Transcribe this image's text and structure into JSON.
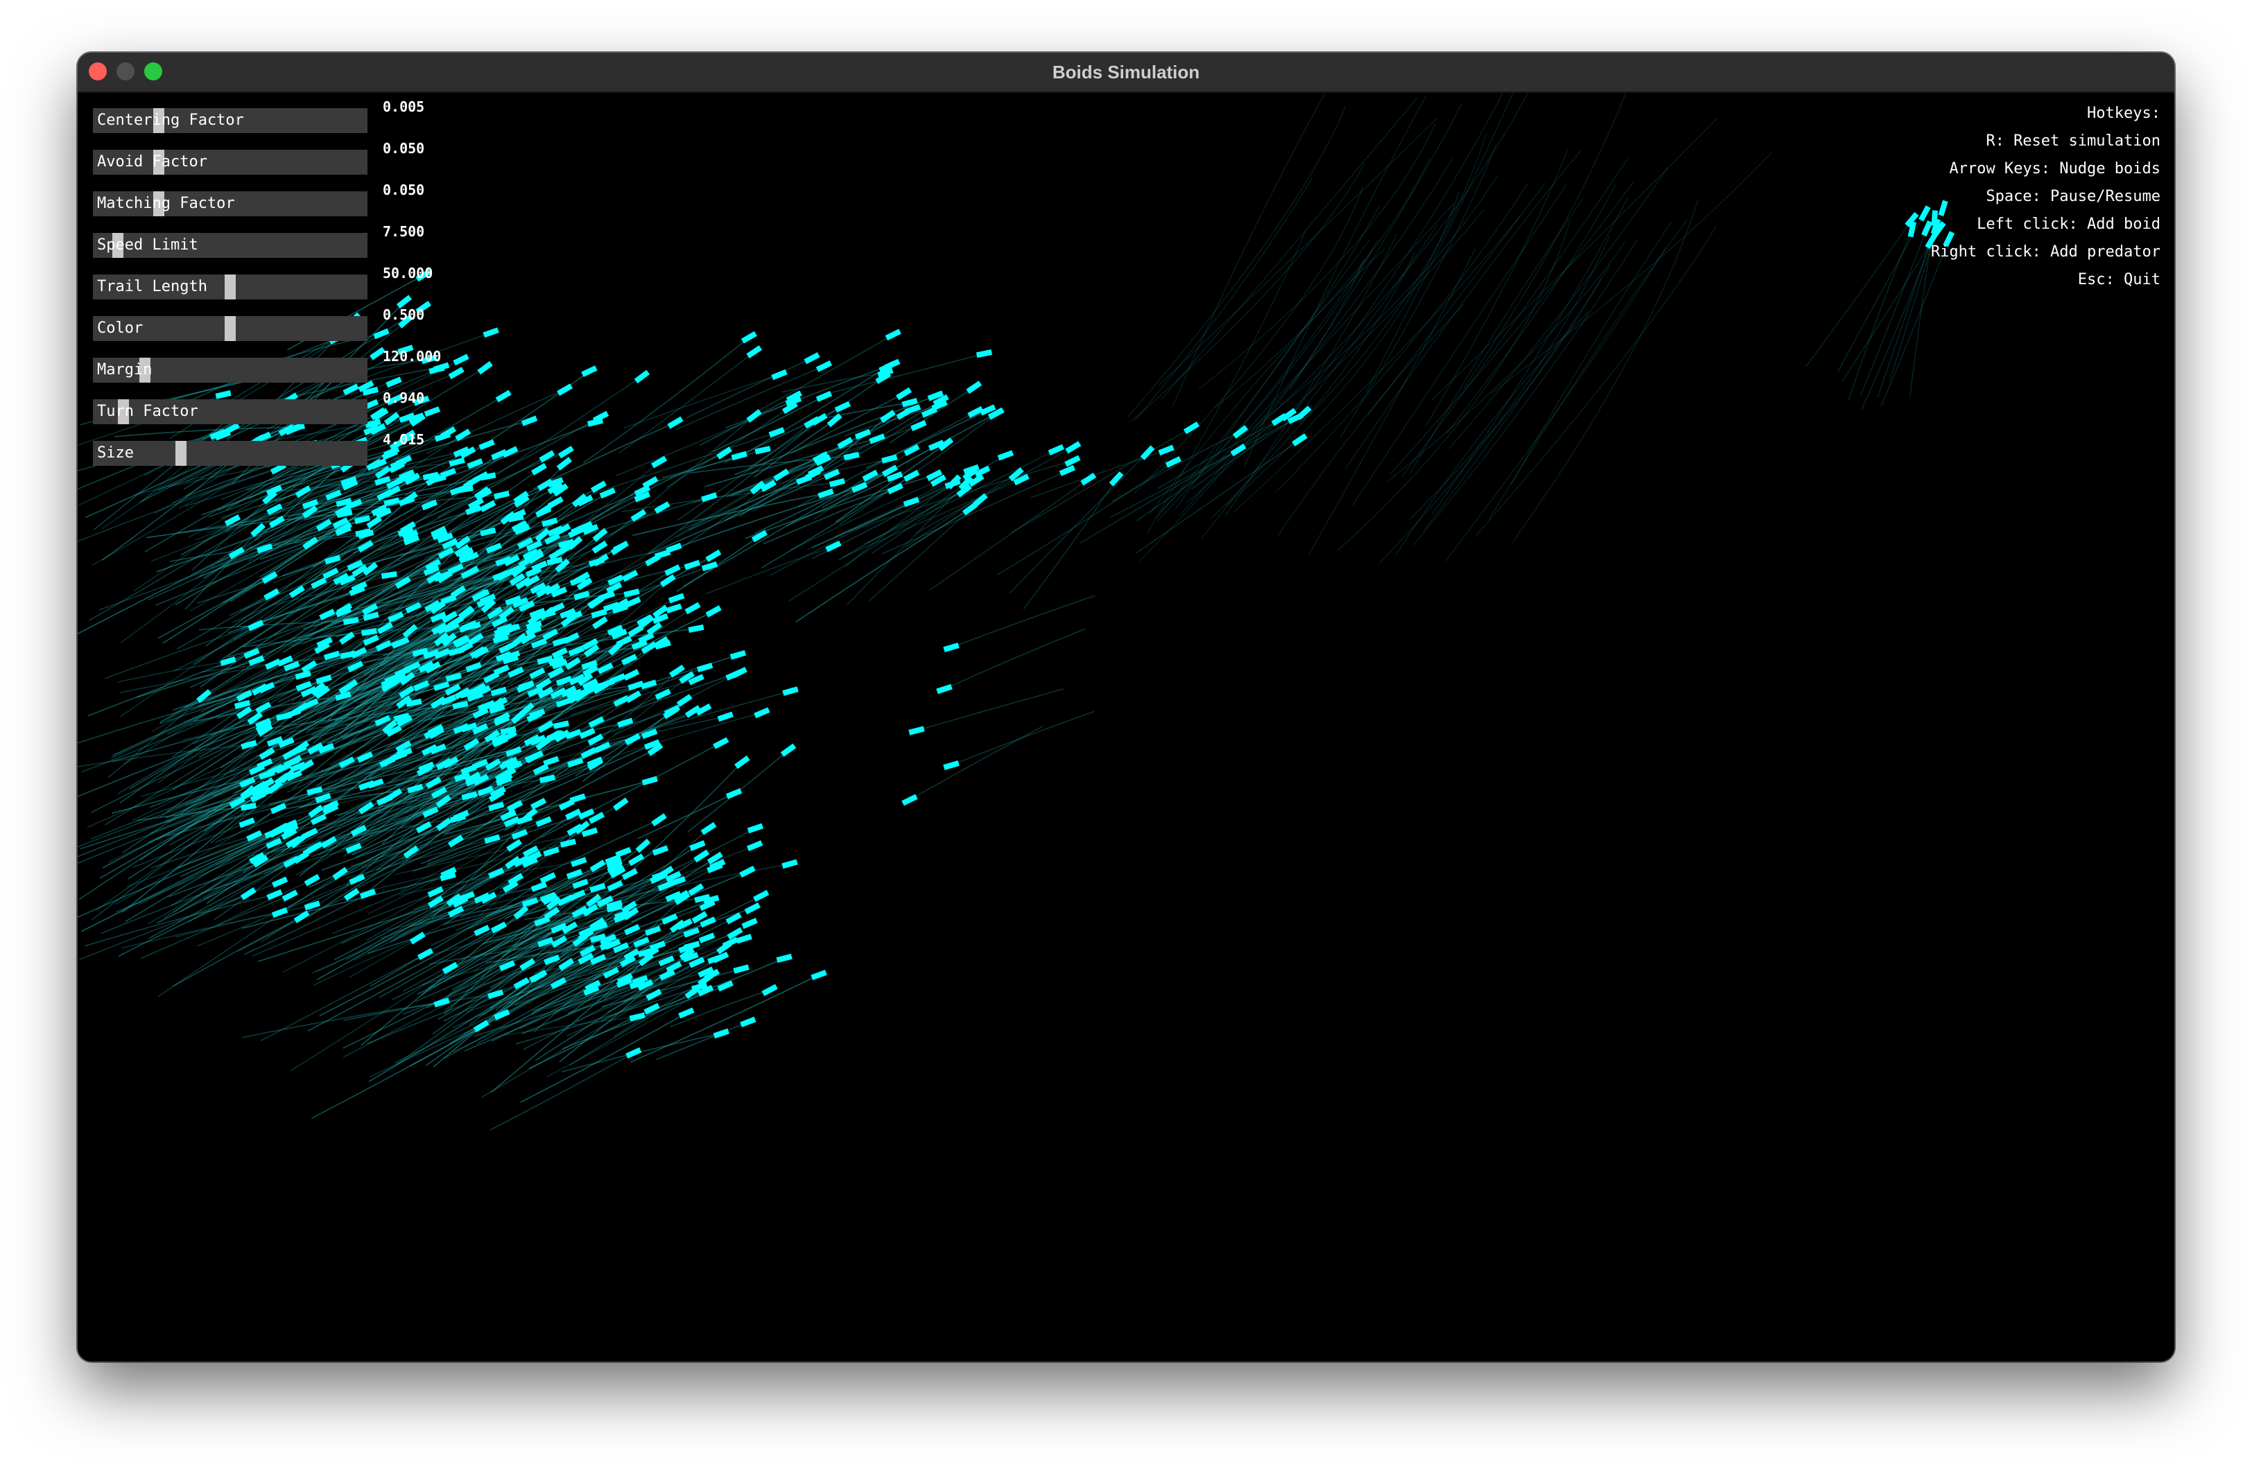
{
  "window": {
    "title": "Boids Simulation"
  },
  "sliders": [
    {
      "label": "Centering Factor",
      "value": "0.005",
      "fraction": 0.24
    },
    {
      "label": "Avoid Factor",
      "value": "0.050",
      "fraction": 0.24
    },
    {
      "label": "Matching Factor",
      "value": "0.050",
      "fraction": 0.24
    },
    {
      "label": "Speed Limit",
      "value": "7.500",
      "fraction": 0.09
    },
    {
      "label": "Trail Length",
      "value": "50.000",
      "fraction": 0.5
    },
    {
      "label": "Color",
      "value": "0.500",
      "fraction": 0.5
    },
    {
      "label": "Margin",
      "value": "120.000",
      "fraction": 0.19
    },
    {
      "label": "Turn Factor",
      "value": "0.940",
      "fraction": 0.11
    },
    {
      "label": "Size",
      "value": "4.015",
      "fraction": 0.32
    }
  ],
  "hotkeys": {
    "title": "Hotkeys:",
    "items": [
      "R: Reset simulation",
      "Arrow Keys: Nudge boids",
      "Space: Pause/Resume",
      "Left click: Add boid",
      "Right click: Add predator",
      "Esc: Quit"
    ]
  },
  "colors": {
    "boid": "#00ffff",
    "trail": "#1fa8a8",
    "background": "#000000",
    "titlebar": "#2e2e2e",
    "slider_track": "#3a3a3a",
    "slider_thumb": "#c8c8c8",
    "close_button": "#ff5f57",
    "minimize_button": "#505050",
    "zoom_button": "#28c840"
  },
  "icons": {
    "close": "close-icon",
    "minimize": "minimize-icon",
    "zoom": "zoom-icon"
  }
}
